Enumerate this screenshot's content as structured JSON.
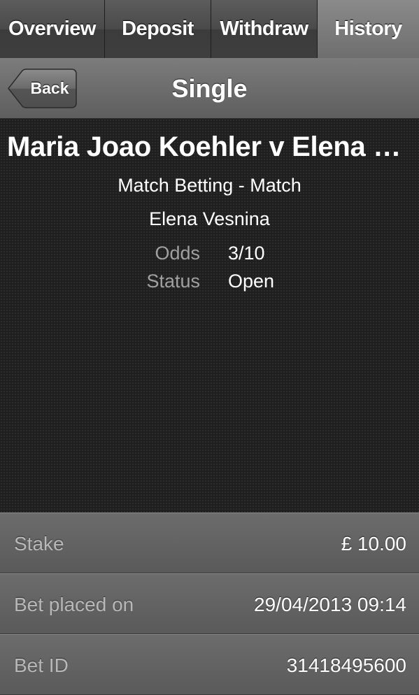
{
  "tabs": [
    {
      "label": "Overview",
      "active": false
    },
    {
      "label": "Deposit",
      "active": false
    },
    {
      "label": "Withdraw",
      "active": false
    },
    {
      "label": "History",
      "active": true
    }
  ],
  "navbar": {
    "back_label": "Back",
    "title": "Single"
  },
  "bet": {
    "event": "Maria Joao Koehler v Elena Vesnina",
    "market": "Match Betting - Match",
    "selection": "Elena Vesnina",
    "odds_label": "Odds",
    "odds_value": "3/10",
    "status_label": "Status",
    "status_value": "Open"
  },
  "details": [
    {
      "label": "Stake",
      "value": "£ 10.00"
    },
    {
      "label": "Bet placed on",
      "value": "29/04/2013 09:14"
    },
    {
      "label": "Bet ID",
      "value": "31418495600"
    }
  ]
}
